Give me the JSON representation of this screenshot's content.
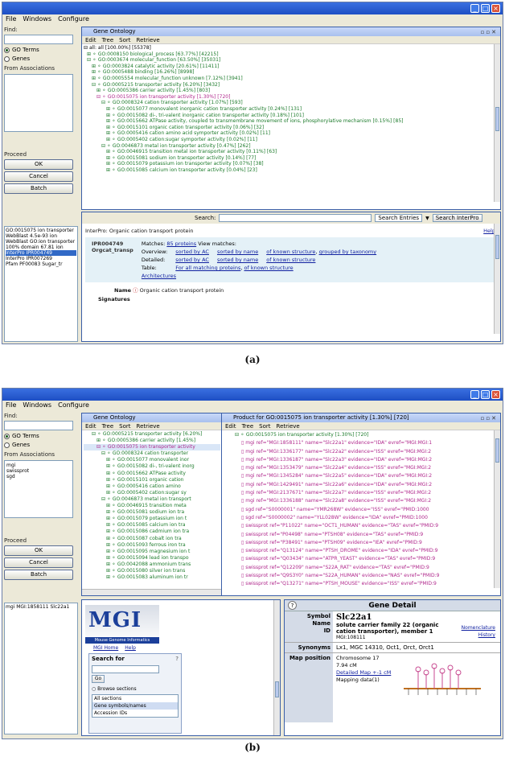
{
  "panel_a": {
    "caption": "(a)",
    "menu": [
      "File",
      "Windows",
      "Configure"
    ],
    "left": {
      "find_label": "Find:",
      "radio_go": "GO Terms",
      "radio_genes": "Genes",
      "from_assoc_label": "From Associations",
      "proceed_label": "Proceed",
      "ok": "OK",
      "cancel": "Cancel",
      "batch": "Batch"
    },
    "results": [
      "GO:0015075 ion transporter",
      "WebBlast 4.5e-93 ion",
      "WebBlast GO:ion transporter",
      "100% domain 67.81 ion",
      "InterPro IPR004749",
      "InterPro IPR007269",
      "Pfam PF00083 Sugar_tr"
    ],
    "go_window": {
      "title": "Gene Ontology",
      "menu": [
        "Edit",
        "Tree",
        "Sort",
        "Retrieve"
      ],
      "tree": [
        "all: all [100.00%] [55378]",
        "GO:0008150 biological_process [63.77%] [42215]",
        "GO:0003674 molecular_function [63.50%] [35031]",
        "GO:0003824 catalytic activity [20.61%] [11411]",
        "GO:0005488 binding [16.26%] [8998]",
        "GO:0005554 molecular_function unknown [7.12%] [3941]",
        "GO:0005215 transporter activity [6.20%] [3432]",
        "GO:0005386 carrier activity [1.45%] [803]",
        "GO:0015075 ion transporter activity [1.30%] [720]",
        "GO:0008324 cation transporter activity [1.07%] [593]",
        "GO:0015077 monovalent inorganic cation transporter activity [0.24%] [131]",
        "GO:0015082 di-, tri-valent inorganic cation transporter activity [0.18%] [101]",
        "GO:0015662 ATPase activity, coupled to transmembrane movement of ions, phosphorylative mechanism [0.15%] [85]",
        "GO:0015101 organic cation transporter activity [0.06%] [32]",
        "GO:0005416 cation amino acid symporter activity [0.02%] [11]",
        "GO:0005402 cation:sugar symporter activity [0.02%] [11]",
        "GO:0046873 metal ion transporter activity [0.47%] [262]",
        "GO:0046915 transition metal ion transporter activity [0.11%] [63]",
        "GO:0015081 sodium ion transporter activity [0.14%] [77]",
        "GO:0015079 potassium ion transporter activity [0.07%] [38]",
        "GO:0015085 calcium ion transporter activity [0.04%] [23]"
      ]
    },
    "interpro": {
      "search_label": "Search:",
      "search_entries": "Search Entries",
      "search_button": "Search InterPro",
      "heading": "InterPro: Organic cation transport protein",
      "help": "Help",
      "id": "IPR004749",
      "short_name": "Orgcat_transp",
      "matches_label": "Matches:",
      "matches_value": "85 proteins",
      "view_matches": "View matches:",
      "overview_label": "Overview:",
      "detailed_label": "Detailed:",
      "table_label": "Table:",
      "sorted_ac": "sorted by AC",
      "sorted_name": "sorted by name",
      "known_structure": "of known structure",
      "grouped_taxonomy": "grouped by taxonomy",
      "table_link": "For all matching proteins",
      "table_link2": "of known structure",
      "architectures": "Architectures",
      "name_label": "Name",
      "name_value": "Organic cation transport protein",
      "signatures_label": "Signatures"
    }
  },
  "panel_b": {
    "caption": "(b)",
    "menu": [
      "File",
      "Windows",
      "Configure"
    ],
    "left": {
      "find_label": "Find:",
      "radio_go": "GO Terms",
      "radio_genes": "Genes",
      "from_assoc_label": "From Associations",
      "assoc_items": [
        "mgi",
        "swissprot",
        "sgd"
      ],
      "proceed_label": "Proceed",
      "ok": "OK",
      "cancel": "Cancel",
      "batch": "Batch"
    },
    "results": [
      "mgi MGI:1858111 Slc22a1"
    ],
    "go_window": {
      "title": "Gene Ontology",
      "menu": [
        "Edit",
        "Tree",
        "Sort",
        "Retrieve"
      ],
      "tree": [
        "GO:0005215 transporter activity [6.20%]",
        "GO:0005386 carrier activity [1.45%]",
        "GO:0015075 ion transporter activity",
        "GO:0008324 cation transporter",
        "GO:0015077 monovalent inor",
        "GO:0015082 di-, tri-valent inorg",
        "GO:0015662 ATPase activity",
        "GO:0015101 organic cation",
        "GO:0005416 cation amino",
        "GO:0005402 cation:sugar sy",
        "GO:0046873 metal ion transport",
        "GO:0046915 transition meta",
        "GO:0015081 sodium ion tra",
        "GO:0015079 potassium ion t",
        "GO:0015085 calcium ion tra",
        "GO:0015086 cadmium ion tra",
        "GO:0015087 cobalt ion tra",
        "GO:0015093 ferrous iron tra",
        "GO:0015095 magnesium ion t",
        "GO:0015094 lead ion transpo",
        "GO:0042088 ammonium trans",
        "GO:0015080 silver ion trans",
        "GO:0015083 aluminum ion tr"
      ]
    },
    "product_window": {
      "title": "Product for GO:0015075 ion transporter activity [1.30%] [720]",
      "menu": [
        "Edit",
        "Tree",
        "Sort",
        "Retrieve"
      ],
      "root": "GO:0015075 ion transporter activity [1.30%] [720]",
      "rows": [
        "mgi ref=\"MGI:1858111\" name=\"Slc22a1\" evidence=\"IDA\" evref=\"MGI:MGI:1",
        "mgi ref=\"MGI:1336177\" name=\"Slc22a2\" evidence=\"ISS\" evref=\"MGI:MGI:2",
        "mgi ref=\"MGI:1336187\" name=\"Slc22a3\" evidence=\"IDA\" evref=\"MGI:MGI:2",
        "mgi ref=\"MGI:1353479\" name=\"Slc22a4\" evidence=\"ISS\" evref=\"MGI:MGI:2",
        "mgi ref=\"MGI:1345284\" name=\"Slc22a5\" evidence=\"IDA\" evref=\"MGI:MGI:2",
        "mgi ref=\"MGI:1429491\" name=\"Slc22a6\" evidence=\"IDA\" evref=\"MGI:MGI:2",
        "mgi ref=\"MGI:2137671\" name=\"Slc22a7\" evidence=\"ISS\" evref=\"MGI:MGI:2",
        "mgi ref=\"MGI:1336188\" name=\"Slc22a8\" evidence=\"ISS\" evref=\"MGI:MGI:2",
        "sgd ref=\"S0000001\" name=\"YMR268W\" evidence=\"ISS\" evref=\"PMID:1000",
        "sgd ref=\"S0000002\" name=\"YLL028W\" evidence=\"IDA\" evref=\"PMID:1000",
        "swissprot ref=\"P11022\" name=\"OCT1_HUMAN\" evidence=\"TAS\" evref=\"PMID:9",
        "swissprot ref=\"P04498\" name=\"PTSH08\" evidence=\"TAS\" evref=\"PMID:9",
        "swissprot ref=\"P38491\" name=\"PTSH09\" evidence=\"IEA\" evref=\"PMID:9",
        "swissprot ref=\"Q13124\" name=\"PTSH_DROME\" evidence=\"IDA\" evref=\"PMID:9",
        "swissprot ref=\"Q03434\" name=\"ATPR_YEAST\" evidence=\"TAS\" evref=\"PMID:9",
        "swissprot ref=\"Q12209\" name=\"S22A_RAT\" evidence=\"TAS\" evref=\"PMID:9",
        "swissprot ref=\"Q9S3Y0\" name=\"S22A_HUMAN\" evidence=\"NAS\" evref=\"PMID:9",
        "swissprot ref=\"Q13271\" name=\"PTSH_MOUSE\" evidence=\"ISS\" evref=\"PMID:9"
      ]
    },
    "mgi": {
      "logo": "MGI",
      "tagline": "Mouse Genome Informatics",
      "nav": [
        "MGI Home",
        "Help"
      ],
      "search_label": "Search for",
      "go_button": "Go",
      "browse_label": "Browse sections",
      "options": [
        "All sections",
        "Gene symbols/names",
        "Accession IDs"
      ]
    },
    "gene_detail": {
      "title": "Gene Detail",
      "help_icon_text": "?",
      "symbol_label": "Symbol",
      "symbol_value": "Slc22a1",
      "name_label": "Name",
      "name_value": "solute carrier family 22 (organic cation transporter), member 1",
      "id_label": "ID",
      "id_value": "MGI:108111",
      "nomenclature_link": "Nomenclature",
      "history_link": "History",
      "synonyms_label": "Synonyms",
      "synonyms_value": "Lx1, MGC 14310, Oct1, Orct, Orct1",
      "map_label": "Map position",
      "chromosome": "Chromosome 17",
      "cm": "7.94 cM",
      "detailed_map": "Detailed Map +-1 cM",
      "mapping_data": "Mapping data(1)"
    }
  }
}
